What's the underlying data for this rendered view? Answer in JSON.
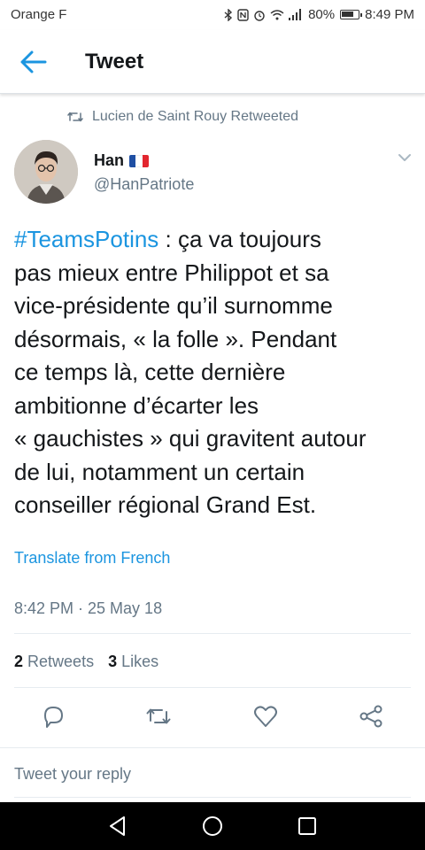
{
  "status_bar": {
    "carrier": "Orange F",
    "battery_percent": "80%",
    "time": "8:49 PM"
  },
  "app_bar": {
    "title": "Tweet"
  },
  "tweet": {
    "retweeted_by": "Lucien de Saint Rouy Retweeted",
    "author": {
      "name": "Han",
      "flag": "🇫🇷",
      "handle": "@HanPatriote"
    },
    "hashtag": "#TeamsPotins",
    "text_lines": [
      " : ça va toujours",
      "pas mieux entre Philippot et sa",
      "vice-présidente qu’il surnomme",
      "désormais, « la folle ». Pendant",
      "ce temps là, cette dernière",
      "ambitionne d’écarter les",
      "« gauchistes » qui gravitent autour",
      "de lui, notamment un certain",
      "conseiller régional Grand Est."
    ],
    "translate_label": "Translate from French",
    "timestamp": "8:42 PM · 25 May 18",
    "retweet_count": "2",
    "retweets_label": "Retweets",
    "like_count": "3",
    "likes_label": "Likes"
  },
  "actions": {
    "reply_icon": "reply-icon",
    "retweet_icon": "retweet-icon",
    "like_icon": "heart-icon",
    "share_icon": "share-icon"
  },
  "reply": {
    "placeholder": "Tweet your reply"
  },
  "colors": {
    "accent": "#1b95e0",
    "muted": "#657786",
    "text": "#14171a"
  }
}
